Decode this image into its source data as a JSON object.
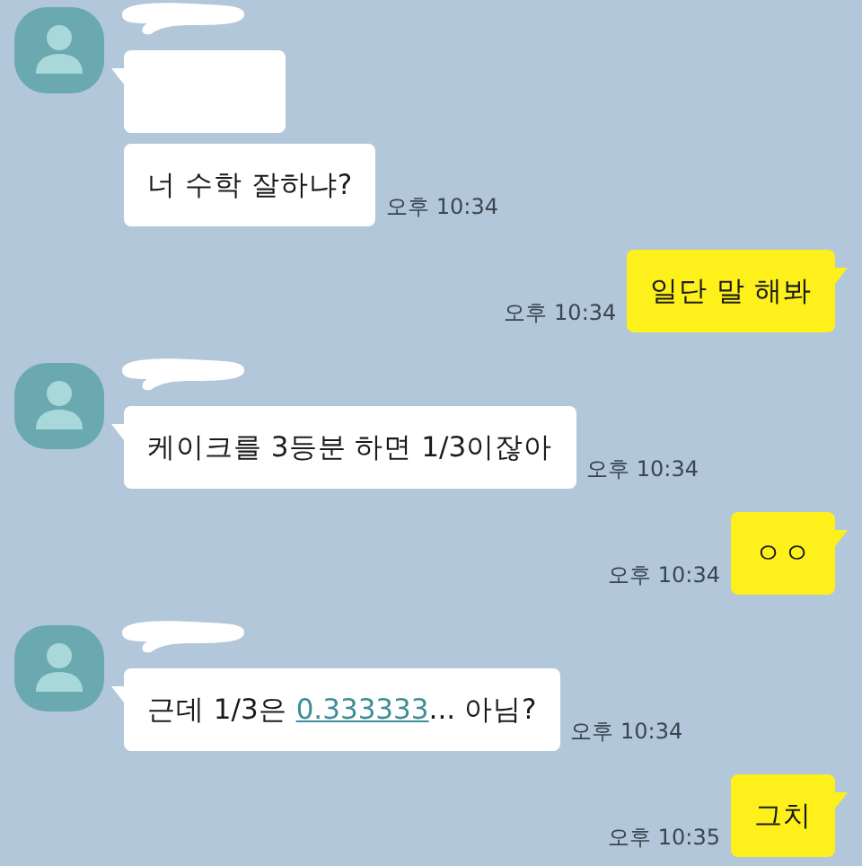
{
  "chat": [
    {
      "kind": "incoming",
      "bubbles": [
        {
          "kind": "redacted"
        },
        {
          "kind": "text",
          "parts": [
            {
              "kind": "plain",
              "text": "너 수학 잘하냐?"
            }
          ]
        }
      ],
      "time": "오후 10:34"
    },
    {
      "kind": "outgoing",
      "bubbles": [
        {
          "kind": "text",
          "parts": [
            {
              "kind": "plain",
              "text": "일단 말 해봐"
            }
          ]
        }
      ],
      "time": "오후 10:34"
    },
    {
      "kind": "incoming",
      "bubbles": [
        {
          "kind": "text",
          "parts": [
            {
              "kind": "plain",
              "text": "케이크를 3등분 하면 1/3이잖아"
            }
          ]
        }
      ],
      "time": "오후 10:34"
    },
    {
      "kind": "outgoing",
      "bubbles": [
        {
          "kind": "text",
          "parts": [
            {
              "kind": "plain",
              "text": "ㅇㅇ"
            }
          ]
        }
      ],
      "time": "오후 10:34"
    },
    {
      "kind": "incoming",
      "bubbles": [
        {
          "kind": "text",
          "parts": [
            {
              "kind": "plain",
              "text": "근데 1/3은 "
            },
            {
              "kind": "link",
              "text": "0.333333"
            },
            {
              "kind": "plain",
              "text": "... 아님?"
            }
          ]
        }
      ],
      "time": "오후 10:34"
    },
    {
      "kind": "outgoing",
      "bubbles": [
        {
          "kind": "text",
          "parts": [
            {
              "kind": "plain",
              "text": "그치"
            }
          ]
        }
      ],
      "time": "오후 10:35"
    }
  ]
}
